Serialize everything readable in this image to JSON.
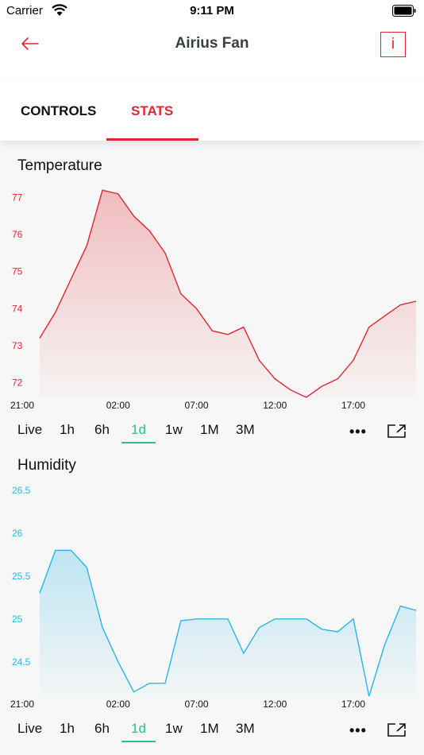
{
  "status_bar": {
    "carrier": "Carrier",
    "time": "9:11 PM"
  },
  "nav": {
    "title": "Airius Fan",
    "info_label": "i"
  },
  "tabs": [
    {
      "label": "CONTROLS",
      "active": false
    },
    {
      "label": "STATS",
      "active": true
    }
  ],
  "colors": {
    "accent": "#e0262e",
    "temperature": "#e0262e",
    "humidity": "#29b6e6",
    "range_active": "#2bbf8a"
  },
  "sections": [
    {
      "title": "Temperature",
      "ranges": [
        "Live",
        "1h",
        "6h",
        "1d",
        "1w",
        "1M",
        "3M"
      ],
      "selected_range": "1d",
      "chart_data": {
        "type": "area",
        "title": "Temperature",
        "x": [
          "21:00",
          "22:00",
          "23:00",
          "00:00",
          "01:00",
          "02:00",
          "03:00",
          "04:00",
          "05:00",
          "06:00",
          "07:00",
          "08:00",
          "09:00",
          "10:00",
          "11:00",
          "12:00",
          "13:00",
          "14:00",
          "15:00",
          "16:00",
          "17:00",
          "18:00",
          "19:00",
          "20:00",
          "20:30"
        ],
        "values": [
          73.2,
          73.9,
          74.8,
          75.7,
          77.2,
          77.1,
          76.5,
          76.1,
          75.5,
          74.4,
          74.0,
          73.4,
          73.3,
          73.5,
          72.6,
          72.1,
          71.8,
          71.6,
          71.9,
          72.1,
          72.6,
          73.5,
          73.8,
          74.1,
          74.2
        ],
        "x_ticks": [
          "21:00",
          "02:00",
          "07:00",
          "12:00",
          "17:00"
        ],
        "y_ticks": [
          "72",
          "73",
          "74",
          "75",
          "76",
          "77"
        ],
        "ylim": [
          71.6,
          77.4
        ],
        "grid": false
      }
    },
    {
      "title": "Humidity",
      "ranges": [
        "Live",
        "1h",
        "6h",
        "1d",
        "1w",
        "1M",
        "3M"
      ],
      "selected_range": "1d",
      "chart_data": {
        "type": "area",
        "title": "Humidity",
        "x": [
          "21:00",
          "22:00",
          "23:00",
          "00:00",
          "01:00",
          "02:00",
          "03:00",
          "04:00",
          "05:00",
          "06:00",
          "07:00",
          "08:00",
          "09:00",
          "10:00",
          "11:00",
          "12:00",
          "13:00",
          "14:00",
          "15:00",
          "16:00",
          "17:00",
          "18:00",
          "19:00",
          "20:00",
          "20:30"
        ],
        "values": [
          25.3,
          25.8,
          25.8,
          25.6,
          24.9,
          24.5,
          24.15,
          24.25,
          24.25,
          24.98,
          25.0,
          25.0,
          25.0,
          24.6,
          24.9,
          25.0,
          25.0,
          25.0,
          24.88,
          24.85,
          25.0,
          24.1,
          24.7,
          25.15,
          25.1
        ],
        "x_ticks": [
          "21:00",
          "02:00",
          "07:00",
          "12:00",
          "17:00"
        ],
        "y_ticks": [
          "24.5",
          "25",
          "25.5",
          "26",
          "26.5"
        ],
        "ylim": [
          24.1,
          26.6
        ],
        "grid": false
      }
    }
  ]
}
